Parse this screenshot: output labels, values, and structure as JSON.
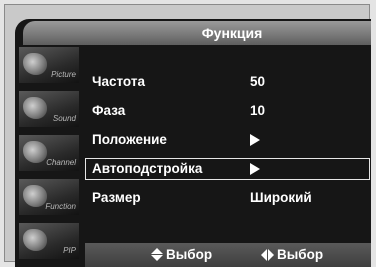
{
  "title": "Функция",
  "sidebar": {
    "items": [
      {
        "label": "Picture",
        "icon": "picture-icon"
      },
      {
        "label": "Sound",
        "icon": "sound-icon"
      },
      {
        "label": "Channel",
        "icon": "channel-icon"
      },
      {
        "label": "Function",
        "icon": "function-icon"
      },
      {
        "label": "PIP",
        "icon": "pip-icon"
      }
    ]
  },
  "menu": {
    "items": [
      {
        "label": "Частота",
        "value": "50"
      },
      {
        "label": "Фаза",
        "value": "10"
      },
      {
        "label": "Положение",
        "value": "",
        "arrow": "right-arrow-icon"
      },
      {
        "label": "Автоподстройка",
        "value": "",
        "arrow": "right-arrow-icon",
        "selected": true
      },
      {
        "label": "Размер",
        "value": "Широкий"
      }
    ]
  },
  "footer": {
    "hints": [
      {
        "icon": "up-down-arrows-icon",
        "label": "Выбор"
      },
      {
        "icon": "left-right-arrows-icon",
        "label": "Выбор"
      }
    ]
  },
  "colors": {
    "screen_background": "#161616",
    "text": "#ffffff",
    "frame": "#c9c9c9"
  }
}
